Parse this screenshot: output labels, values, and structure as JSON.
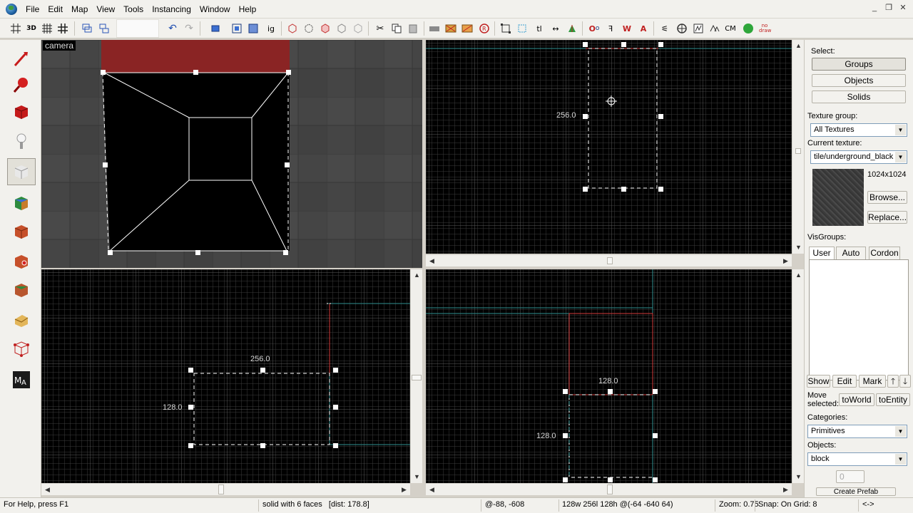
{
  "menu": [
    "File",
    "Edit",
    "Map",
    "View",
    "Tools",
    "Instancing",
    "Window",
    "Help"
  ],
  "window_controls": [
    "_",
    "❐",
    "✕"
  ],
  "viewports": {
    "camera": {
      "label": "camera"
    },
    "top": {
      "dim_left": "256.0"
    },
    "front": {
      "dim_top": "256.0",
      "dim_left": "128.0"
    },
    "side": {
      "dim_top": "128.0",
      "dim_left": "128.0"
    }
  },
  "right_panel": {
    "select_label": "Select:",
    "select_buttons": [
      "Groups",
      "Objects",
      "Solids"
    ],
    "texture_group_label": "Texture group:",
    "texture_group_value": "All Textures",
    "current_texture_label": "Current texture:",
    "current_texture_value": "tile/underground_black",
    "texture_size": "1024x1024",
    "browse_label": "Browse...",
    "replace_label": "Replace...",
    "visgroups_label": "VisGroups:",
    "tabs": [
      "User",
      "Auto",
      "Cordon"
    ],
    "show_label": "Show",
    "edit_label": "Edit",
    "mark_label": "Mark",
    "move_selected_label": "Move\nselected:",
    "to_world_label": "toWorld",
    "to_entity_label": "toEntity",
    "categories_label": "Categories:",
    "categories_value": "Primitives",
    "objects_label": "Objects:",
    "objects_value": "block",
    "faces_value": "0",
    "create_prefab_label": "Create Prefab"
  },
  "toolbar": {
    "m1": "M",
    "m2": "CM",
    "nodraw": "no draw"
  },
  "status": {
    "help": "For Help, press F1",
    "selection": "solid with 6 faces   [dist: 178.8]",
    "coords": "@-88, -608",
    "size": "128w 256l 128h @(-64 -640 64)",
    "zoom": "Zoom: 0.75",
    "snap": "Snap: On Grid: 8",
    "arrows": "<->"
  },
  "colors": {
    "grid_minor": "#3a3a3a",
    "grid_major": "#555555",
    "axis_cyan": "#2f8f8f",
    "selection_red": "#d23a3a",
    "selection_white": "#ffffff"
  }
}
